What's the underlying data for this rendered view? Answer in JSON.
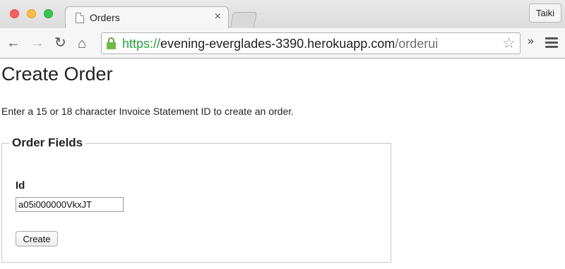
{
  "browser": {
    "tab_title": "Orders",
    "tab_close": "×",
    "profile_name": "Taiki",
    "url": {
      "scheme": "https://",
      "host": "evening-everglades-3390.herokuapp.com",
      "path": "/orderui"
    },
    "icons": {
      "back": "back-arrow-icon",
      "forward": "forward-arrow-icon",
      "reload": "reload-icon",
      "home": "home-icon",
      "secure": "lock-icon",
      "bookmark": "star-icon",
      "extensions": "chevron-double-right-icon",
      "menu": "hamburger-menu-icon"
    },
    "glyphs": {
      "back": "←",
      "forward": "→",
      "reload": "↻",
      "home": "⌂",
      "bookmark": "☆",
      "extensions": "»"
    },
    "colors": {
      "secure_green": "#24a33a",
      "close": "#fc605c",
      "minimize": "#fdbc40",
      "maximize": "#34c84a"
    }
  },
  "page": {
    "title": "Create Order",
    "intro": "Enter a 15 or 18 character Invoice Statement ID to create an order.",
    "fieldset_legend": "Order Fields",
    "id_label": "Id",
    "id_value": "a05i000000VkxJT",
    "create_button": "Create"
  }
}
